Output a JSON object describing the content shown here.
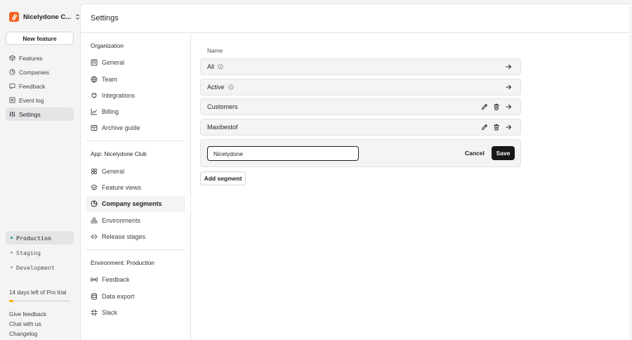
{
  "org": {
    "name": "Nicelydone C...",
    "logo_color": "#f26522"
  },
  "new_feature_label": "New feature",
  "nav": {
    "items": [
      {
        "label": "Features",
        "icon": "box-icon"
      },
      {
        "label": "Companies",
        "icon": "pie-icon"
      },
      {
        "label": "Feedback",
        "icon": "feedback-icon"
      },
      {
        "label": "Event log",
        "icon": "list-icon"
      },
      {
        "label": "Settings",
        "icon": "sliders-icon",
        "active": true
      }
    ]
  },
  "environments": [
    {
      "label": "Production",
      "active": true
    },
    {
      "label": "Staging"
    },
    {
      "label": "Development"
    }
  ],
  "trial": {
    "text": "14 days left of Pro trial",
    "progress": 0.07,
    "color": "#f5b400"
  },
  "footer_links": [
    "Give feedback",
    "Chat with us",
    "Changelog"
  ],
  "page_title": "Settings",
  "settings_nav": {
    "groups": [
      {
        "title": "Organization",
        "items": [
          {
            "label": "General",
            "icon": "building-icon"
          },
          {
            "label": "Team",
            "icon": "globe-icon"
          },
          {
            "label": "Integrations",
            "icon": "plug-icon"
          },
          {
            "label": "Billing",
            "icon": "chart-line-icon"
          },
          {
            "label": "Archive guide",
            "icon": "archive-icon"
          }
        ]
      },
      {
        "title": "App: Nicelydone Club",
        "items": [
          {
            "label": "General",
            "icon": "grid-icon"
          },
          {
            "label": "Feature views",
            "icon": "layers-icon"
          },
          {
            "label": "Company segments",
            "icon": "pie-icon",
            "active": true
          },
          {
            "label": "Environments",
            "icon": "environments-icon"
          },
          {
            "label": "Release stages",
            "icon": "release-icon"
          }
        ]
      },
      {
        "title": "Environment: Production",
        "items": [
          {
            "label": "Feedback",
            "icon": "feedback-signal-icon"
          },
          {
            "label": "Data export",
            "icon": "database-icon"
          },
          {
            "label": "Slack",
            "icon": "slack-icon"
          }
        ]
      }
    ]
  },
  "segments": {
    "column_name": "Name",
    "rows": [
      {
        "name": "All",
        "info": true,
        "editable": false
      },
      {
        "name": "Active",
        "info": true,
        "editable": false
      },
      {
        "name": "Customers",
        "info": false,
        "editable": true
      },
      {
        "name": "Maxibestof",
        "info": false,
        "editable": true
      }
    ],
    "edit_value": "Nicelydone",
    "cancel_label": "Cancel",
    "save_label": "Save",
    "add_label": "Add segment"
  }
}
